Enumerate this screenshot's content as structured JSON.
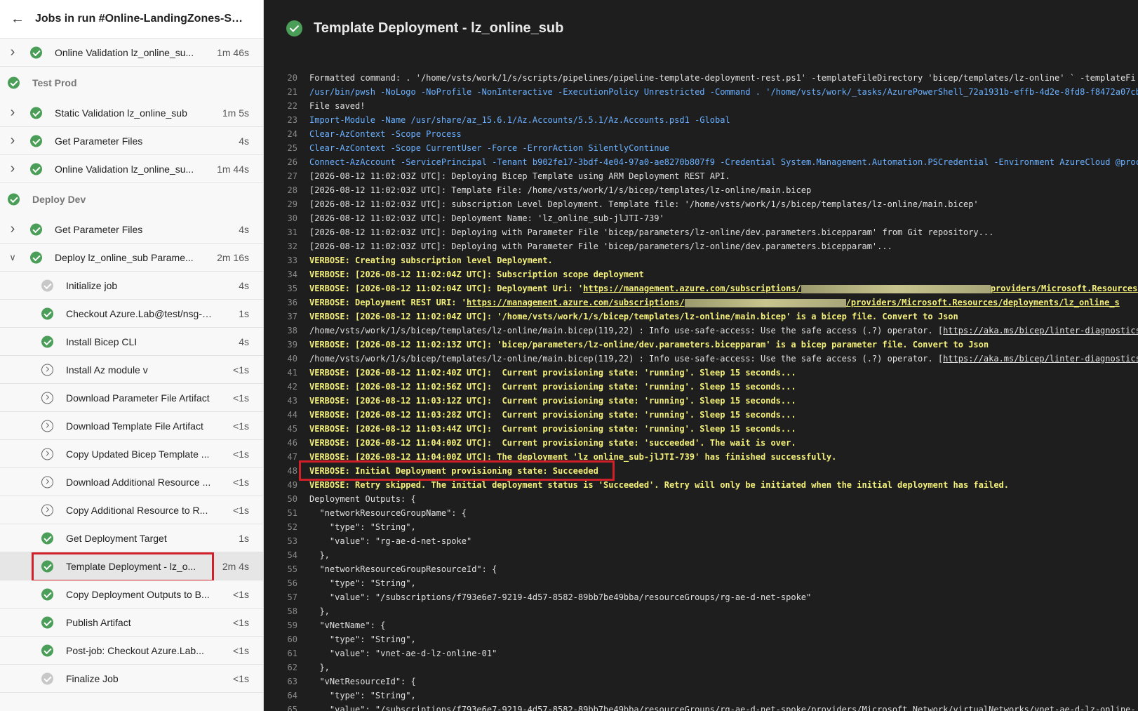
{
  "sidebar": {
    "title": "Jobs in run #Online-LandingZones-Sub_...",
    "rows": [
      {
        "kind": "job",
        "chevron": "right",
        "status": "success",
        "label": "Online Validation lz_online_su...",
        "duration": "1m 46s"
      },
      {
        "kind": "stage",
        "status": "success",
        "label": "Test Prod"
      },
      {
        "kind": "job",
        "chevron": "right",
        "status": "success",
        "label": "Static Validation lz_online_sub",
        "duration": "1m 5s"
      },
      {
        "kind": "job",
        "chevron": "right",
        "status": "success",
        "label": "Get Parameter Files",
        "duration": "4s"
      },
      {
        "kind": "job",
        "chevron": "right",
        "status": "success",
        "label": "Online Validation lz_online_su...",
        "duration": "1m 44s"
      },
      {
        "kind": "stage",
        "status": "success",
        "label": "Deploy Dev"
      },
      {
        "kind": "job",
        "chevron": "right",
        "status": "success",
        "label": "Get Parameter Files",
        "duration": "4s"
      },
      {
        "kind": "job",
        "chevron": "down",
        "status": "success",
        "label": "Deploy lz_online_sub Parame...",
        "duration": "2m 16s"
      },
      {
        "kind": "step",
        "status": "skipped",
        "label": "Initialize job",
        "duration": "4s"
      },
      {
        "kind": "step",
        "status": "success",
        "label": "Checkout Azure.Lab@test/nsg-u...",
        "duration": "1s"
      },
      {
        "kind": "step",
        "status": "success",
        "label": "Install Bicep CLI",
        "duration": "4s"
      },
      {
        "kind": "step",
        "status": "ncircle",
        "label": "Install Az module v",
        "duration": "<1s"
      },
      {
        "kind": "step",
        "status": "ncircle",
        "label": "Download Parameter File Artifact",
        "duration": "<1s"
      },
      {
        "kind": "step",
        "status": "ncircle",
        "label": "Download Template File Artifact",
        "duration": "<1s"
      },
      {
        "kind": "step",
        "status": "ncircle",
        "label": "Copy Updated Bicep Template ...",
        "duration": "<1s"
      },
      {
        "kind": "step",
        "status": "ncircle",
        "label": "Download Additional Resource ...",
        "duration": "<1s"
      },
      {
        "kind": "step",
        "status": "ncircle",
        "label": "Copy Additional Resource to R...",
        "duration": "<1s"
      },
      {
        "kind": "step",
        "status": "success",
        "label": "Get Deployment Target",
        "duration": "1s"
      },
      {
        "kind": "step",
        "status": "success",
        "label": "Template Deployment - lz_o...",
        "duration": "2m 4s",
        "selected": true
      },
      {
        "kind": "step",
        "status": "success",
        "label": "Copy Deployment Outputs to B...",
        "duration": "<1s"
      },
      {
        "kind": "step",
        "status": "success",
        "label": "Publish Artifact",
        "duration": "<1s"
      },
      {
        "kind": "step",
        "status": "success",
        "label": "Post-job: Checkout Azure.Lab...",
        "duration": "<1s"
      },
      {
        "kind": "step",
        "status": "skipped",
        "label": "Finalize Job",
        "duration": "<1s"
      }
    ]
  },
  "main": {
    "title": "Template Deployment - lz_online_sub"
  },
  "log": [
    {
      "n": "20",
      "s": "plain",
      "parts": [
        {
          "t": "Formatted command: . '/home/vsts/work/1/s/scripts/pipelines/pipeline-template-deployment-rest.ps1' -templateFileDirectory 'bicep/templates/lz-online' ` -templateFi"
        }
      ]
    },
    {
      "n": "21",
      "s": "cmd",
      "parts": [
        {
          "t": "/usr/bin/pwsh -NoLogo -NoProfile -NonInteractive -ExecutionPolicy Unrestricted -Command . '/home/vsts/work/_tasks/AzurePowerShell_72a1931b-effb-4d2e-8fd8-f8472a07cb"
        }
      ]
    },
    {
      "n": "22",
      "s": "plain",
      "parts": [
        {
          "t": "File saved!"
        }
      ]
    },
    {
      "n": "23",
      "s": "cmd",
      "parts": [
        {
          "t": "Import-Module -Name /usr/share/az_15.6.1/Az.Accounts/5.5.1/Az.Accounts.psd1 -Global"
        }
      ]
    },
    {
      "n": "24",
      "s": "cmd",
      "parts": [
        {
          "t": "Clear-AzContext -Scope Process"
        }
      ]
    },
    {
      "n": "25",
      "s": "cmd",
      "parts": [
        {
          "t": "Clear-AzContext -Scope CurrentUser -Force -ErrorAction SilentlyContinue"
        }
      ]
    },
    {
      "n": "26",
      "s": "cmd",
      "parts": [
        {
          "t": "Connect-AzAccount -ServicePrincipal -Tenant b902fe17-3bdf-4e04-97a0-ae8270b807f9 -Credential System.Management.Automation.PSCredential -Environment AzureCloud @proc"
        }
      ]
    },
    {
      "n": "27",
      "s": "plain",
      "parts": [
        {
          "t": "[2026-08-12 11:02:03Z UTC]: Deploying Bicep Template using ARM Deployment REST API."
        }
      ]
    },
    {
      "n": "28",
      "s": "plain",
      "parts": [
        {
          "t": "[2026-08-12 11:02:03Z UTC]: Template File: /home/vsts/work/1/s/bicep/templates/lz-online/main.bicep"
        }
      ]
    },
    {
      "n": "29",
      "s": "plain",
      "parts": [
        {
          "t": "[2026-08-12 11:02:03Z UTC]: subscription Level Deployment. Template file: '/home/vsts/work/1/s/bicep/templates/lz-online/main.bicep'"
        }
      ]
    },
    {
      "n": "30",
      "s": "plain",
      "parts": [
        {
          "t": "[2026-08-12 11:02:03Z UTC]: Deployment Name: 'lz_online_sub-jlJTI-739'"
        }
      ]
    },
    {
      "n": "31",
      "s": "plain",
      "parts": [
        {
          "t": "[2026-08-12 11:02:03Z UTC]: Deploying with Parameter File 'bicep/parameters/lz-online/dev.parameters.bicepparam' from Git repository..."
        }
      ]
    },
    {
      "n": "32",
      "s": "plain",
      "parts": [
        {
          "t": "[2026-08-12 11:02:03Z UTC]: Deploying with Parameter File 'bicep/parameters/lz-online/dev.parameters.bicepparam'..."
        }
      ]
    },
    {
      "n": "33",
      "s": "verbose",
      "parts": [
        {
          "t": "VERBOSE: Creating subscription level Deployment."
        }
      ]
    },
    {
      "n": "34",
      "s": "verbose",
      "parts": [
        {
          "t": "VERBOSE: [2026-08-12 11:02:04Z UTC]: Subscription scope deployment"
        }
      ]
    },
    {
      "n": "35",
      "s": "verbose",
      "parts": [
        {
          "t": "VERBOSE: [2026-08-12 11:02:04Z UTC]: Deployment Uri: '"
        },
        {
          "t": "https://management.azure.com/subscriptions/",
          "link": true
        },
        {
          "redact": "long"
        },
        {
          "t": "providers/Microsoft.Resources/",
          "link": true
        }
      ]
    },
    {
      "n": "36",
      "s": "verbose",
      "parts": [
        {
          "t": "VERBOSE: Deployment REST URI: '"
        },
        {
          "t": "https://management.azure.com/subscriptions/",
          "link": true
        },
        {
          "redact": "short"
        },
        {
          "t": "/providers/Microsoft.Resources/deployments/lz_online_s",
          "link": true
        }
      ]
    },
    {
      "n": "37",
      "s": "verbose",
      "parts": [
        {
          "t": "VERBOSE: [2026-08-12 11:02:04Z UTC]: '/home/vsts/work/1/s/bicep/templates/lz-online/main.bicep' is a bicep file. Convert to Json"
        }
      ]
    },
    {
      "n": "38",
      "s": "plain",
      "parts": [
        {
          "t": "/home/vsts/work/1/s/bicep/templates/lz-online/main.bicep(119,22) : Info use-safe-access: Use the safe access (.?) operator. ["
        },
        {
          "t": "https://aka.ms/bicep/linter-diagnostics",
          "link": true
        }
      ]
    },
    {
      "n": "39",
      "s": "verbose",
      "parts": [
        {
          "t": "VERBOSE: [2026-08-12 11:02:13Z UTC]: 'bicep/parameters/lz-online/dev.parameters.bicepparam' is a bicep parameter file. Convert to Json"
        }
      ]
    },
    {
      "n": "40",
      "s": "plain",
      "parts": [
        {
          "t": "/home/vsts/work/1/s/bicep/templates/lz-online/main.bicep(119,22) : Info use-safe-access: Use the safe access (.?) operator. ["
        },
        {
          "t": "https://aka.ms/bicep/linter-diagnostics",
          "link": true
        }
      ]
    },
    {
      "n": "41",
      "s": "verbose",
      "parts": [
        {
          "t": "VERBOSE: [2026-08-12 11:02:40Z UTC]:  Current provisioning state: 'running'. Sleep 15 seconds..."
        }
      ]
    },
    {
      "n": "42",
      "s": "verbose",
      "parts": [
        {
          "t": "VERBOSE: [2026-08-12 11:02:56Z UTC]:  Current provisioning state: 'running'. Sleep 15 seconds..."
        }
      ]
    },
    {
      "n": "43",
      "s": "verbose",
      "parts": [
        {
          "t": "VERBOSE: [2026-08-12 11:03:12Z UTC]:  Current provisioning state: 'running'. Sleep 15 seconds..."
        }
      ]
    },
    {
      "n": "44",
      "s": "verbose",
      "parts": [
        {
          "t": "VERBOSE: [2026-08-12 11:03:28Z UTC]:  Current provisioning state: 'running'. Sleep 15 seconds..."
        }
      ]
    },
    {
      "n": "45",
      "s": "verbose",
      "parts": [
        {
          "t": "VERBOSE: [2026-08-12 11:03:44Z UTC]:  Current provisioning state: 'running'. Sleep 15 seconds..."
        }
      ]
    },
    {
      "n": "46",
      "s": "verbose",
      "parts": [
        {
          "t": "VERBOSE: [2026-08-12 11:04:00Z UTC]:  Current provisioning state: 'succeeded'. The wait is over."
        }
      ]
    },
    {
      "n": "47",
      "s": "verbose",
      "parts": [
        {
          "t": "VERBOSE: [2026-08-12 11:04:00Z UTC]: The deployment 'lz_online_sub-jlJTI-739' has finished successfully."
        }
      ]
    },
    {
      "n": "48",
      "s": "verbose",
      "parts": [
        {
          "t": "VERBOSE: Initial Deployment provisioning state: Succeeded"
        }
      ]
    },
    {
      "n": "49",
      "s": "verbose",
      "parts": [
        {
          "t": "VERBOSE: Retry skipped. The initial deployment status is 'Succeeded'. Retry will only be initiated when the initial deployment has failed."
        }
      ]
    },
    {
      "n": "50",
      "s": "plain",
      "parts": [
        {
          "t": "Deployment Outputs: {"
        }
      ]
    },
    {
      "n": "51",
      "s": "plain",
      "parts": [
        {
          "t": "  \"networkResourceGroupName\": {"
        }
      ]
    },
    {
      "n": "52",
      "s": "plain",
      "parts": [
        {
          "t": "    \"type\": \"String\","
        }
      ]
    },
    {
      "n": "53",
      "s": "plain",
      "parts": [
        {
          "t": "    \"value\": \"rg-ae-d-net-spoke\""
        }
      ]
    },
    {
      "n": "54",
      "s": "plain",
      "parts": [
        {
          "t": "  },"
        }
      ]
    },
    {
      "n": "55",
      "s": "plain",
      "parts": [
        {
          "t": "  \"networkResourceGroupResourceId\": {"
        }
      ]
    },
    {
      "n": "56",
      "s": "plain",
      "parts": [
        {
          "t": "    \"type\": \"String\","
        }
      ]
    },
    {
      "n": "57",
      "s": "plain",
      "parts": [
        {
          "t": "    \"value\": \"/subscriptions/f793e6e7-9219-4d57-8582-89bb7be49bba/resourceGroups/rg-ae-d-net-spoke\""
        }
      ]
    },
    {
      "n": "58",
      "s": "plain",
      "parts": [
        {
          "t": "  },"
        }
      ]
    },
    {
      "n": "59",
      "s": "plain",
      "parts": [
        {
          "t": "  \"vNetName\": {"
        }
      ]
    },
    {
      "n": "60",
      "s": "plain",
      "parts": [
        {
          "t": "    \"type\": \"String\","
        }
      ]
    },
    {
      "n": "61",
      "s": "plain",
      "parts": [
        {
          "t": "    \"value\": \"vnet-ae-d-lz-online-01\""
        }
      ]
    },
    {
      "n": "62",
      "s": "plain",
      "parts": [
        {
          "t": "  },"
        }
      ]
    },
    {
      "n": "63",
      "s": "plain",
      "parts": [
        {
          "t": "  \"vNetResourceId\": {"
        }
      ]
    },
    {
      "n": "64",
      "s": "plain",
      "parts": [
        {
          "t": "    \"type\": \"String\","
        }
      ]
    },
    {
      "n": "65",
      "s": "plain",
      "parts": [
        {
          "t": "    \"value\": \"/subscriptions/f793e6e7-9219-4d57-8582-89bb7be49bba/resourceGroups/rg-ae-d-net-spoke/providers/Microsoft.Network/virtualNetworks/vnet-ae-d-lz-online-"
        }
      ]
    }
  ],
  "colors": {
    "success": "#4a9e58",
    "skipped": "#c8c8c8",
    "highlight": "#d0202a",
    "verbose": "#f4f07a",
    "command": "#6ab0ff"
  },
  "icons": {
    "back": "arrow-left-icon",
    "expand": "chevron-right-icon",
    "collapse": "chevron-down-icon",
    "success": "success-check-icon",
    "skipped": "skipped-check-icon",
    "not_run": "not-run-circle-icon"
  }
}
